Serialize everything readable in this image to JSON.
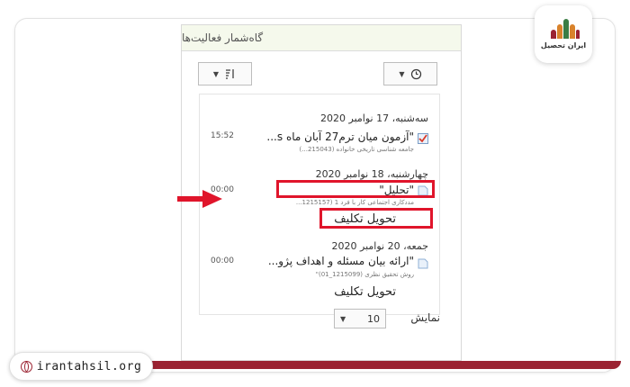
{
  "brand": {
    "logo_text": "ایران تحصیل",
    "site_url": "irantahsil.org",
    "accent": "#9b2332"
  },
  "panel": {
    "title": "گاه‌شمار فعالیت‌ها",
    "filter_icon": "clock-icon",
    "sort_icon": "sort-list-icon"
  },
  "events": [
    {
      "date": "سه‌شنبه، 17 نوامبر 2020",
      "title": "\"آزمون میان ترم27 آبان ماه s...",
      "subtitle": "جامعه شناسی تاریخی خانواده (215043...)",
      "time": "15:52",
      "icon": "quiz-check-icon",
      "action": ""
    },
    {
      "date": "چهارشنبه، 18 نوامبر 2020",
      "title": "\"تحلیل\"",
      "subtitle": "مددکاری اجتماعی کار با فرد 1 (1215157...",
      "time": "00:00",
      "icon": "assignment-icon",
      "action": "تحویل تکلیف"
    },
    {
      "date": "جمعه، 20 نوامبر 2020",
      "title": "\"ارائه بیان مسئله و اهداف پژو...",
      "subtitle": "روش تحقیق نظری (1215099_01)\"",
      "time": "00:00",
      "icon": "assignment-icon",
      "action": "تحویل تکلیف"
    }
  ],
  "footer": {
    "show_label": "نمایش",
    "show_value": "10"
  },
  "colors": {
    "highlight": "#e0152b",
    "header_bg": "#f5f9ec"
  }
}
